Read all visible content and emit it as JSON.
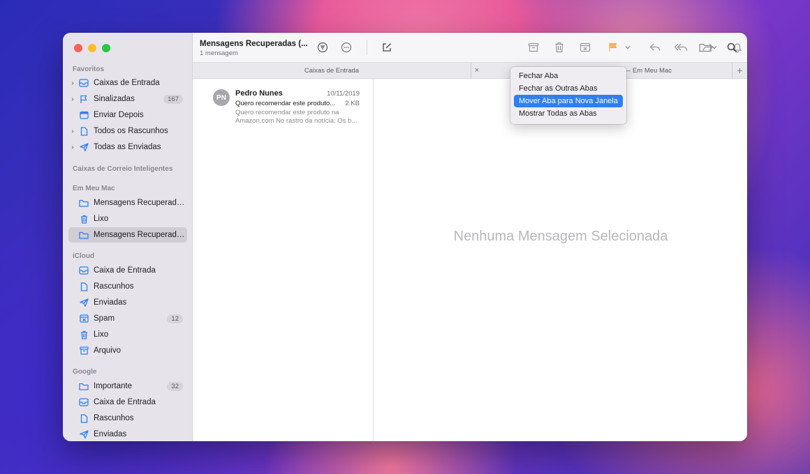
{
  "toolbar": {
    "title": "Mensagens Recuperadas (...",
    "subtitle": "1 mensagem"
  },
  "sidebar": {
    "sections": [
      {
        "title": "Favoritos",
        "items": [
          {
            "label": "Caixas de Entrada",
            "icon": "inbox-icon",
            "chevron": true
          },
          {
            "label": "Sinalizadas",
            "icon": "flag-icon",
            "chevron": true,
            "badge": "167"
          },
          {
            "label": "Enviar Depois",
            "icon": "calendar-icon",
            "chevron": false
          },
          {
            "label": "Todos os Rascunhos",
            "icon": "draft-icon",
            "chevron": true
          },
          {
            "label": "Todas as Enviadas",
            "icon": "sent-icon",
            "chevron": true
          }
        ]
      },
      {
        "title": "Caixas de Correio Inteligentes",
        "items": []
      },
      {
        "title": "Em Meu Mac",
        "items": [
          {
            "label": "Mensagens Recuperada...",
            "icon": "folder-icon"
          },
          {
            "label": "Lixo",
            "icon": "trash-icon"
          },
          {
            "label": "Mensagens Recuperada...",
            "icon": "folder-icon",
            "selected": true
          }
        ]
      },
      {
        "title": "iCloud",
        "items": [
          {
            "label": "Caixa de Entrada",
            "icon": "inbox-icon"
          },
          {
            "label": "Rascunhos",
            "icon": "draft-icon"
          },
          {
            "label": "Enviadas",
            "icon": "sent-icon"
          },
          {
            "label": "Spam",
            "icon": "junk-icon",
            "badge": "12"
          },
          {
            "label": "Lixo",
            "icon": "trash-icon"
          },
          {
            "label": "Arquivo",
            "icon": "archive-icon"
          }
        ]
      },
      {
        "title": "Google",
        "items": [
          {
            "label": "Importante",
            "icon": "folder-icon",
            "badge": "32"
          },
          {
            "label": "Caixa de Entrada",
            "icon": "inbox-icon"
          },
          {
            "label": "Rascunhos",
            "icon": "draft-icon"
          },
          {
            "label": "Enviadas",
            "icon": "sent-icon"
          }
        ]
      }
    ]
  },
  "tabs": {
    "tab1": "Caixas de Entrada",
    "tab2": ") — Em Meu Mac"
  },
  "message": {
    "initials": "PN",
    "sender": "Pedro Nunes",
    "date": "10/11/2019",
    "subject": "Quero recomendar este produto...",
    "size": "2 KB",
    "preview_line1": "Quero recomendar este produto na",
    "preview_line2": "Amazon.com No rastro da notícia: Os b..."
  },
  "viewer": {
    "empty_text": "Nenhuma Mensagem Selecionada"
  },
  "context_menu": {
    "items": [
      "Fechar Aba",
      "Fechar as Outras Abas",
      "Mover Aba para Nova Janela",
      "Mostrar Todas as Abas"
    ],
    "highlighted_index": 2
  },
  "colors": {
    "accent": "#2f7ff1",
    "icon_blue": "#2f7ff1",
    "flag_orange": "#f5a623"
  }
}
